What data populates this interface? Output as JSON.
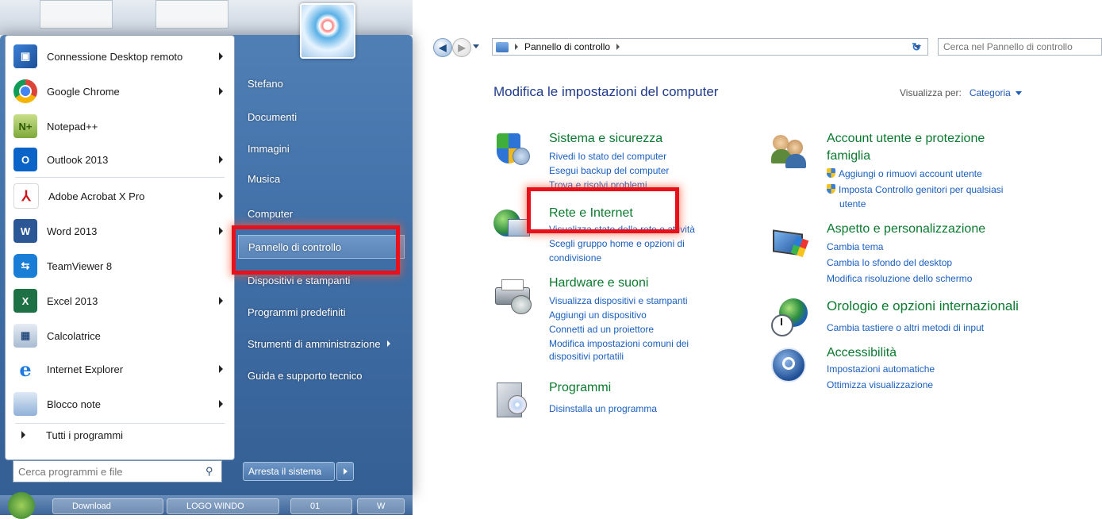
{
  "start_menu": {
    "programs": [
      {
        "label": "Connessione Desktop remoto",
        "icon": "remote-desktop-icon",
        "has_arrow": true
      },
      {
        "label": "Google Chrome",
        "icon": "chrome-icon",
        "has_arrow": true
      },
      {
        "label": "Notepad++",
        "icon": "notepad-plus-plus-icon",
        "has_arrow": false
      },
      {
        "label": "Outlook 2013",
        "icon": "outlook-icon",
        "has_arrow": true
      },
      {
        "label": "Adobe Acrobat X Pro",
        "icon": "acrobat-icon",
        "has_arrow": true
      },
      {
        "label": "Word 2013",
        "icon": "word-icon",
        "has_arrow": true
      },
      {
        "label": "TeamViewer 8",
        "icon": "teamviewer-icon",
        "has_arrow": false
      },
      {
        "label": "Excel 2013",
        "icon": "excel-icon",
        "has_arrow": true
      },
      {
        "label": "Calcolatrice",
        "icon": "calculator-icon",
        "has_arrow": false
      },
      {
        "label": "Internet Explorer",
        "icon": "internet-explorer-icon",
        "has_arrow": true
      },
      {
        "label": "Blocco note",
        "icon": "notepad-icon",
        "has_arrow": true
      }
    ],
    "all_programs": "Tutti i programmi",
    "search_placeholder": "Cerca programmi e file",
    "right_items": [
      {
        "label": "Stefano"
      },
      {
        "label": "Documenti"
      },
      {
        "label": "Immagini"
      },
      {
        "label": "Musica"
      },
      {
        "label": "Computer"
      },
      {
        "label": "Pannello di controllo"
      },
      {
        "label": "Dispositivi e stampanti"
      },
      {
        "label": "Programmi predefiniti"
      },
      {
        "label": "Strumenti di amministrazione"
      },
      {
        "label": "Guida e supporto tecnico"
      }
    ],
    "shutdown": "Arresta il sistema",
    "taskbar_buttons": [
      "Download",
      "LOGO WINDO",
      "01",
      "W"
    ]
  },
  "control_panel": {
    "breadcrumb": "Pannello di controllo",
    "search_placeholder": "Cerca nel Pannello di controllo",
    "heading": "Modifica le impostazioni del computer",
    "view_by_label": "Visualizza per:",
    "view_by_value": "Categoria",
    "categories": [
      {
        "title": "Sistema e sicurezza",
        "links": [
          "Rivedi lo stato del computer",
          "Esegui backup del computer",
          "Trova e risolvi problemi"
        ]
      },
      {
        "title": "Rete e Internet",
        "links": [
          "Visualizza stato della rete e attività",
          "Scegli gruppo home e opzioni di",
          "condivisione"
        ]
      },
      {
        "title": "Hardware e suoni",
        "links": [
          "Visualizza dispositivi e stampanti",
          "Aggiungi un dispositivo",
          "Connetti ad un proiettore",
          "Modifica impostazioni comuni dei",
          "dispositivi portatili"
        ]
      },
      {
        "title": "Programmi",
        "links": [
          "Disinstalla un programma"
        ]
      },
      {
        "title": "Account utente e protezione",
        "title2": "famiglia",
        "links": [
          "Aggiungi o rimuovi account utente",
          "Imposta Controllo genitori per qualsiasi",
          "utente"
        ]
      },
      {
        "title": "Aspetto e personalizzazione",
        "links": [
          "Cambia tema",
          "Cambia lo sfondo del desktop",
          "Modifica risoluzione dello schermo"
        ]
      },
      {
        "title": "Orologio e opzioni internazionali",
        "links": [
          "Cambia tastiere o altri metodi di input"
        ]
      },
      {
        "title": "Accessibilità",
        "links": [
          "Impostazioni automatiche",
          "Ottimizza visualizzazione"
        ]
      }
    ]
  },
  "colors": {
    "category_title": "#0a7a2e",
    "link": "#1a5fbf",
    "heading": "#1e3a8a",
    "highlight_box": "#e8101a"
  }
}
